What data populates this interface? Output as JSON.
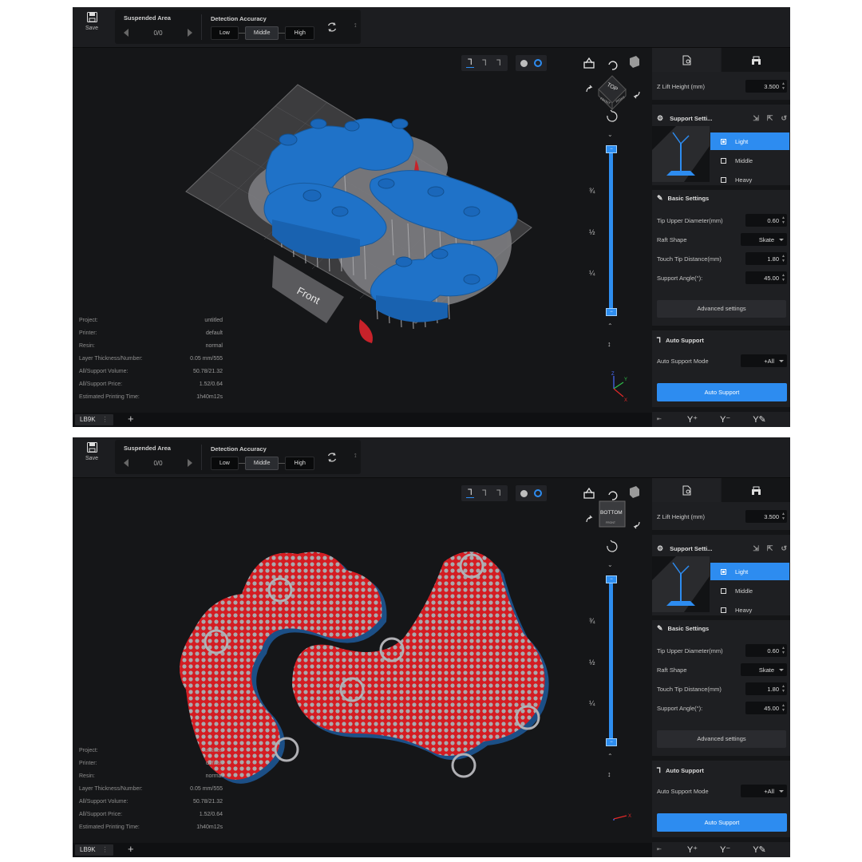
{
  "toolbar": {
    "save_label": "Save",
    "suspended_area": {
      "title": "Suspended Area",
      "value": "0/0"
    },
    "detection_accuracy": {
      "title": "Detection Accuracy",
      "options": [
        "Low",
        "Middle",
        "High"
      ],
      "selected": "Middle"
    }
  },
  "viewport": {
    "plate_label": "Front",
    "slider_marks": [
      "¾",
      "½",
      "¼"
    ],
    "axis_labels": {
      "x": "X",
      "y": "Y",
      "z": "Z"
    }
  },
  "views": [
    {
      "id": "top",
      "nav_cube_face": "TOP",
      "nav_cube_sides": [
        "FRONT",
        "RIGHT"
      ],
      "camera": "isometric"
    },
    {
      "id": "bottom",
      "nav_cube_face": "BOTTOM",
      "nav_cube_sides": [
        "FRONT"
      ],
      "camera": "bottom"
    }
  ],
  "info": {
    "rows": [
      {
        "label": "Project:",
        "value": "untitled"
      },
      {
        "label": "Printer:",
        "value": "default"
      },
      {
        "label": "Resin:",
        "value": "normal"
      },
      {
        "label": "Layer Thickness/Number:",
        "value": "0.05 mm/555"
      },
      {
        "label": "All/Support Volume:",
        "value": "50.78/21.32"
      },
      {
        "label": "All/Support Price:",
        "value": "1.52/0.64"
      },
      {
        "label": "Estimated Printing Time:",
        "value": "1h40m12s"
      }
    ]
  },
  "statusbar": {
    "tab_label": "LB9K",
    "tab_menu": "⋮",
    "add_label": "+"
  },
  "right_panel": {
    "z_lift": {
      "label": "Z Lift Height (mm)",
      "value": "3.500"
    },
    "support_settings": {
      "title": "Support Setti...",
      "levels": [
        "Light",
        "Middle",
        "Heavy"
      ],
      "selected": "Light"
    },
    "basic_settings": {
      "title": "Basic Settings",
      "tip_upper_diameter": {
        "label": "Tip Upper Diameter(mm)",
        "value": "0.60"
      },
      "raft_shape": {
        "label": "Raft Shape",
        "value": "Skate"
      },
      "touch_tip_distance": {
        "label": "Touch Tip Distance(mm)",
        "value": "1.80"
      },
      "support_angle": {
        "label": "Support Angle(°):",
        "value": "45.00"
      },
      "advanced_label": "Advanced settings"
    },
    "auto_support": {
      "title": "Auto Support",
      "mode": {
        "label": "Auto Support Mode",
        "value": "+All"
      },
      "button_label": "Auto Support"
    }
  },
  "colors": {
    "accent": "#2d8cf0",
    "model_blue": "#1f72c8",
    "support_gray": "#9a9a9a",
    "overhang_red": "#d41c22",
    "background": "#151618",
    "panel": "#1e1f22"
  }
}
